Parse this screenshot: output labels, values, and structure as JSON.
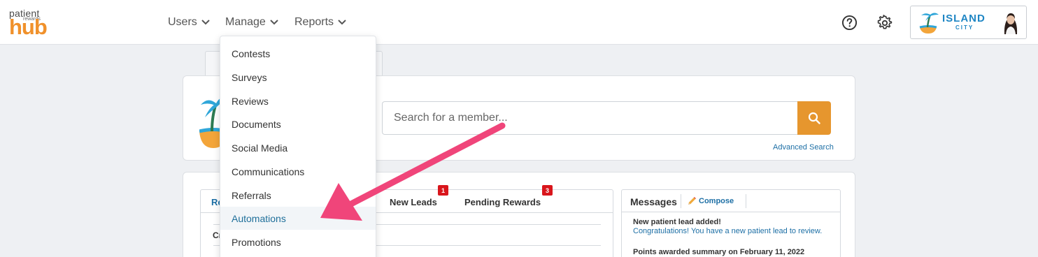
{
  "logo": {
    "line1": "patient",
    "line2": "rewards",
    "line3": "hub"
  },
  "nav": {
    "users": "Users",
    "manage": "Manage",
    "reports": "Reports"
  },
  "brand": {
    "name": "ISLAND",
    "sub": "CITY"
  },
  "manage_menu": {
    "items": [
      "Contests",
      "Surveys",
      "Reviews",
      "Documents",
      "Social Media",
      "Communications",
      "Referrals",
      "Automations",
      "Promotions"
    ],
    "active": "Automations"
  },
  "search": {
    "placeholder": "Search for a member...",
    "advanced": "Advanced Search"
  },
  "left_panel": {
    "tab_partial": "Re",
    "tab_new_leads": "New Leads",
    "new_leads_count": "1",
    "tab_pending": "Pending Rewards",
    "pending_count": "3",
    "row_partial": "Cr"
  },
  "messages": {
    "title": "Messages",
    "compose": "Compose",
    "msg1_title": "New patient lead added!",
    "msg1_body": "Congratulations! You have a new patient lead to review.",
    "msg2_title": "Points awarded summary on February 11, 2022"
  },
  "colors": {
    "accent_orange": "#e6962e",
    "link_blue": "#1d6fa5",
    "badge_red": "#d9161c",
    "annotation_pink": "#f0457a"
  }
}
